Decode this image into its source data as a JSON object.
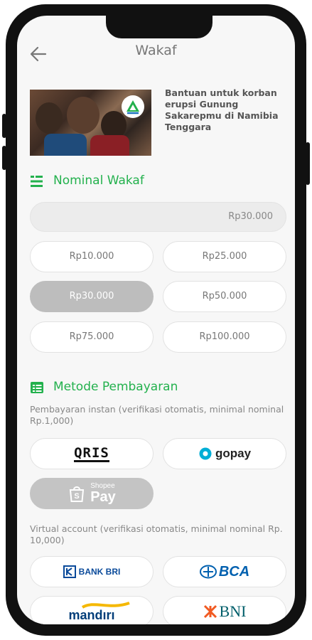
{
  "header": {
    "title": "Wakaf"
  },
  "campaign": {
    "title": "Bantuan untuk korban erupsi Gunung Sakarepmu di Namibia Tenggara"
  },
  "nominal": {
    "section_title": "Nominal Wakaf",
    "custom_amount": "Rp30.000",
    "options": [
      "Rp10.000",
      "Rp25.000",
      "Rp30.000",
      "Rp50.000",
      "Rp75.000",
      "Rp100.000"
    ],
    "selected_index": 2
  },
  "payment": {
    "section_title": "Metode Pembayaran",
    "instant_desc": "Pembayaran instan (verifikasi otomatis, minimal nominal Rp.1,000)",
    "instant_methods": [
      {
        "label": "QRIS",
        "icon": "qris-logo"
      },
      {
        "label": "gopay",
        "icon": "gopay-logo"
      },
      {
        "label": "Shopee",
        "label2": "Pay",
        "icon": "shopeepay-logo"
      }
    ],
    "va_desc": "Virtual account (verifikasi otomatis, minimal nominal Rp. 10,000)",
    "va_methods": [
      {
        "label": "BANK BRI",
        "icon": "bri-logo"
      },
      {
        "label": "BCA",
        "icon": "bca-logo"
      },
      {
        "label": "mandırı",
        "icon": "mandiri-logo"
      },
      {
        "label": "BNI",
        "icon": "bni-logo"
      }
    ]
  },
  "colors": {
    "accent": "#23b14d",
    "selected": "#bdbdbd",
    "bri": "#0a4a9a",
    "bca": "#0060af",
    "bni": "#f15a22",
    "mandiri": "#003d79",
    "mandiri_gold": "#f5b800"
  }
}
